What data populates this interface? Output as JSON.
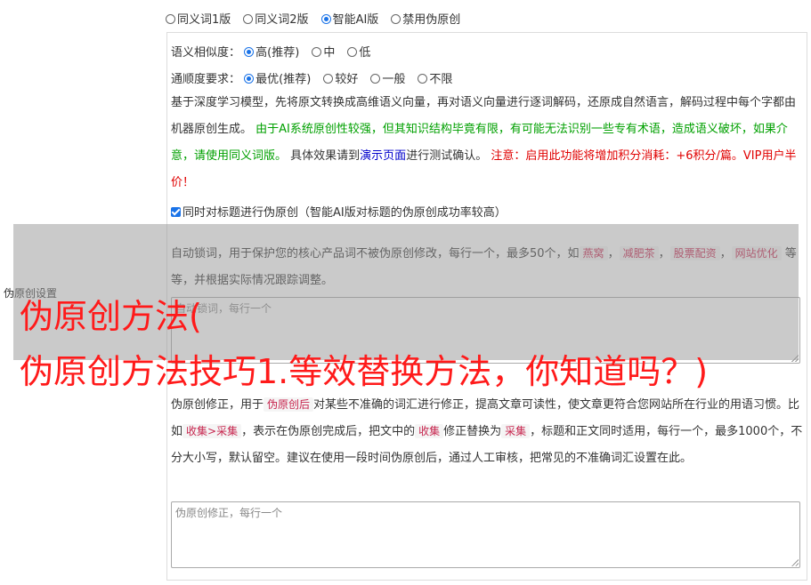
{
  "modes": [
    {
      "label": "同义词1版",
      "checked": false
    },
    {
      "label": "同义词2版",
      "checked": false
    },
    {
      "label": "智能AI版",
      "checked": true
    },
    {
      "label": "禁用伪原创",
      "checked": false
    }
  ],
  "similarity": {
    "label": "语义相似度：",
    "options": [
      {
        "label": "高(推荐)",
        "checked": true
      },
      {
        "label": "中",
        "checked": false
      },
      {
        "label": "低",
        "checked": false
      }
    ]
  },
  "fluency": {
    "label": "通顺度要求：",
    "options": [
      {
        "label": "最优(推荐)",
        "checked": true
      },
      {
        "label": "较好",
        "checked": false
      },
      {
        "label": "一般",
        "checked": false
      },
      {
        "label": "不限",
        "checked": false
      }
    ]
  },
  "description": {
    "intro": "基于深度学习模型，先将原文转换成高维语义向量，再对语义向量进行逐词解码，还原成自然语言，解码过程中每个字都由机器原创生成。",
    "warning_green": "由于AI系统原创性较强，但其知识结构毕竟有限，有可能无法识别一些专有术语，造成语义破坏，如果介意，请使用同义词版。",
    "effect_prefix": "具体效果请到",
    "demo_link": "演示页面",
    "effect_suffix": "进行测试确认。",
    "notice_red": "注意：启用此功能将增加积分消耗：+6积分/篇。VIP用户半价！"
  },
  "title_checkbox": {
    "label": "同时对标题进行伪原创（智能AI版对标题的伪原创成功率较高）",
    "checked": true
  },
  "lock_words": {
    "text_prefix": "自动锁词，用于保护您的核心产品词不被伪原创修改，每行一个，最多50个，如",
    "examples": [
      "燕窝",
      "减肥茶",
      "股票配资",
      "网站优化"
    ],
    "text_suffix": "等等，并根据实际情况跟踪调整。",
    "placeholder": "自动锁词，每行一个"
  },
  "settings_label": "伪原创设置",
  "headline": {
    "line1": "伪原创方法(",
    "line2": "伪原创方法技巧1.等效替换方法，你知道吗？)"
  },
  "correction": {
    "text1": "伪原创修正，用于",
    "tag1": "伪原创后",
    "text2": "对某些不准确的词汇进行修正，提高文章可读性，使文章更符合您网站所在行业的用语习惯。比如",
    "tag2": "收集>采集",
    "text3": "，表示在伪原创完成后，把文中的",
    "tag3": "收集",
    "text4": "修正替换为",
    "tag4": "采集",
    "text5": "，标题和正文同时适用，每行一个，最多1000个，不分大小写，默认留空。建议在使用一段时间伪原创后，通过人工审核，把常见的不准确词汇设置在此。",
    "placeholder": "伪原创修正，每行一个"
  },
  "colors": {
    "green": "#00a000",
    "red": "#e00000",
    "blue": "#0000cc",
    "headline": "#ff1a1a",
    "accent": "#1a73e8"
  }
}
